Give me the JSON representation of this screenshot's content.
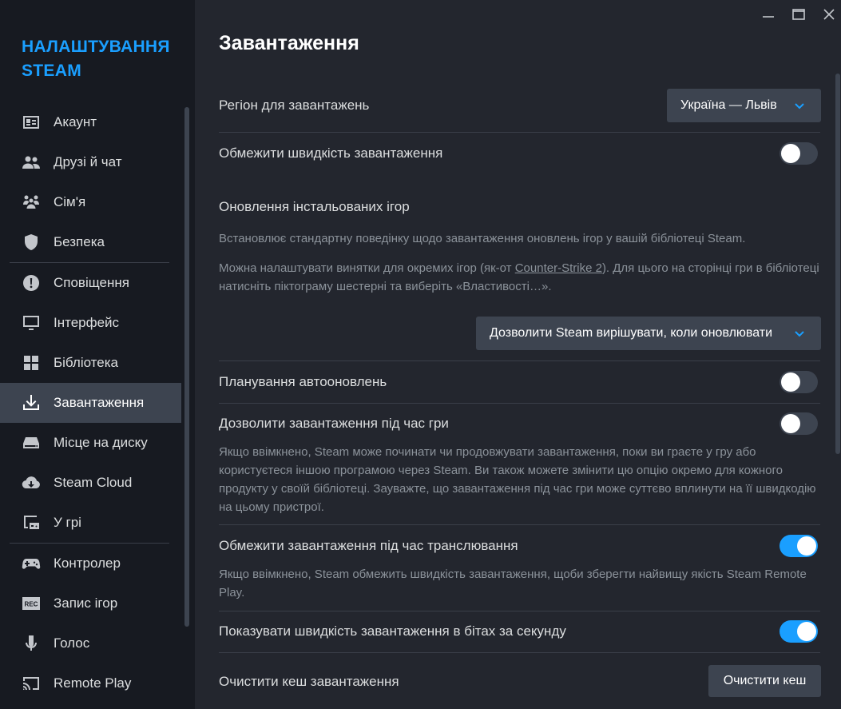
{
  "sidebar": {
    "title": "НАЛАШТУВАННЯ STEAM",
    "items": [
      {
        "label": "Акаунт",
        "icon": "account-card-icon"
      },
      {
        "label": "Друзі й чат",
        "icon": "friends-icon"
      },
      {
        "label": "Сім'я",
        "icon": "family-icon"
      },
      {
        "label": "Безпека",
        "icon": "shield-icon"
      },
      {
        "label": "Сповіщення",
        "icon": "alert-icon"
      },
      {
        "label": "Інтерфейс",
        "icon": "monitor-icon"
      },
      {
        "label": "Бібліотека",
        "icon": "grid-icon"
      },
      {
        "label": "Завантаження",
        "icon": "download-icon"
      },
      {
        "label": "Місце на диску",
        "icon": "drive-icon"
      },
      {
        "label": "Steam Cloud",
        "icon": "cloud-icon"
      },
      {
        "label": "У грі",
        "icon": "in-game-icon"
      },
      {
        "label": "Контролер",
        "icon": "gamepad-icon"
      },
      {
        "label": "Запис ігор",
        "icon": "rec-icon"
      },
      {
        "label": "Голос",
        "icon": "microphone-icon"
      },
      {
        "label": "Remote Play",
        "icon": "cast-icon"
      }
    ],
    "active_index": 7
  },
  "main": {
    "title": "Завантаження",
    "region": {
      "label": "Регіон для завантажень",
      "value": "Україна — Львів"
    },
    "limit_speed": {
      "label": "Обмежити швидкість завантаження",
      "on": false
    },
    "updates": {
      "label": "Оновлення інстальованих ігор",
      "desc1": "Встановлює стандартну поведінку щодо завантаження оновлень ігор у вашій бібліотеці Steam.",
      "desc2_pre": "Можна налаштувати винятки для окремих ігор (як-от ",
      "desc2_link": "Counter-Strike 2",
      "desc2_post": "). Для цього на сторінці гри в бібліотеці натисніть піктограму шестерні та виберіть «Властивості…».",
      "dropdown_value": "Дозволити Steam вирішувати, коли оновлювати"
    },
    "schedule": {
      "label": "Планування автооновлень",
      "on": false
    },
    "during_game": {
      "label": "Дозволити завантаження під час гри",
      "on": false,
      "desc": "Якщо ввімкнено, Steam може починати чи продовжувати завантаження, поки ви граєте у гру або користуєтеся іншою програмою через Steam. Ви також можете змінити цю опцію окремо для кожного продукту у своїй бібліотеці. Зауважте, що завантаження під час гри може суттєво вплинути на її швидкодію на цьому пристрої."
    },
    "limit_streaming": {
      "label": "Обмежити завантаження під час транслювання",
      "on": true,
      "desc": "Якщо ввімкнено, Steam обмежить швидкість завантаження, щоби зберегти найвищу якість Steam Remote Play."
    },
    "bits": {
      "label": "Показувати швидкість завантаження в бітах за секунду",
      "on": true
    },
    "clear_cache": {
      "label": "Очистити кеш завантаження",
      "button": "Очистити кеш"
    }
  },
  "colors": {
    "accent": "#1a9fff",
    "background": "#23262e",
    "sidebar": "#171a21",
    "control": "#3d4450"
  }
}
